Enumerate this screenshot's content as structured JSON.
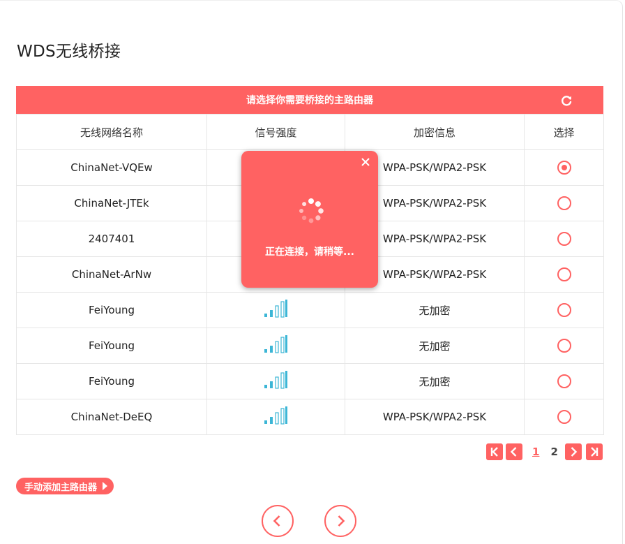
{
  "page": {
    "title": "WDS无线桥接"
  },
  "header": {
    "title": "请选择你需要桥接的主路由器",
    "refresh_icon": "refresh-icon"
  },
  "table": {
    "columns": [
      "无线网络名称",
      "信号强度",
      "加密信息",
      "选择"
    ],
    "rows": [
      {
        "ssid": "ChinaNet-VQEw",
        "encryption": "WPA-PSK/WPA2-PSK",
        "selected": true
      },
      {
        "ssid": "ChinaNet-JTEk",
        "encryption": "WPA-PSK/WPA2-PSK",
        "selected": false
      },
      {
        "ssid": "2407401",
        "encryption": "WPA-PSK/WPA2-PSK",
        "selected": false
      },
      {
        "ssid": "ChinaNet-ArNw",
        "encryption": "WPA-PSK/WPA2-PSK",
        "selected": false
      },
      {
        "ssid": "FeiYoung",
        "encryption": "无加密",
        "selected": false,
        "signal_bars": 4
      },
      {
        "ssid": "FeiYoung",
        "encryption": "无加密",
        "selected": false,
        "signal_bars": 4
      },
      {
        "ssid": "FeiYoung",
        "encryption": "无加密",
        "selected": false,
        "signal_bars": 4
      },
      {
        "ssid": "ChinaNet-DeEQ",
        "encryption": "WPA-PSK/WPA2-PSK",
        "selected": false,
        "signal_bars": 4
      }
    ]
  },
  "pager": {
    "pages": [
      "1",
      "2"
    ],
    "current": "1"
  },
  "manual_add": {
    "label": "手动添加主路由器"
  },
  "popup": {
    "message": "正在连接，请稍等..."
  },
  "colors": {
    "accent": "#ff6262",
    "signal": "#3cb6d6"
  }
}
